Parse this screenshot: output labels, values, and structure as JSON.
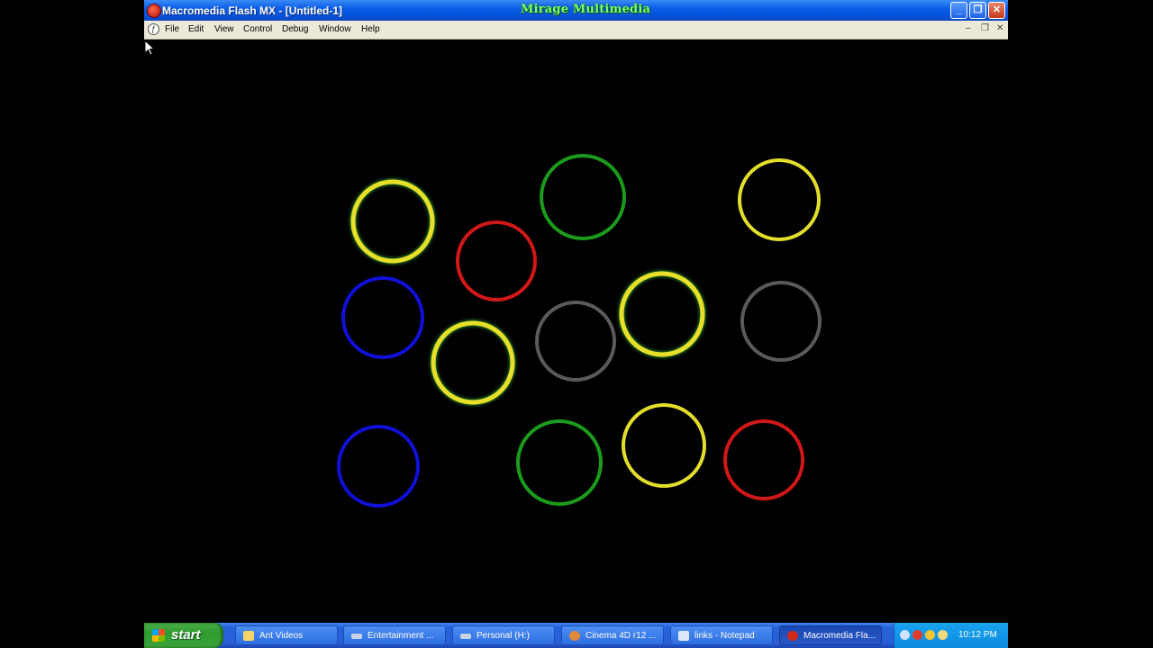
{
  "window": {
    "title": "Macromedia Flash MX - [Untitled-1]",
    "watermark": "Mirage Multimedia",
    "buttons": {
      "minimize": "_",
      "maximize": "❐",
      "close": "✕"
    }
  },
  "menubar": {
    "items": [
      "File",
      "Edit",
      "View",
      "Control",
      "Debug",
      "Window",
      "Help"
    ],
    "mdi_controls": [
      "–",
      "❐",
      "✕"
    ]
  },
  "stage": {
    "background": "#000000",
    "rings": [
      {
        "color": "#e6e02a",
        "glow": true
      },
      {
        "color": "#1c9a1c",
        "glow": false
      },
      {
        "color": "#e2de2a",
        "glow": false
      },
      {
        "color": "#d01818",
        "glow": false
      },
      {
        "color": "#1010d8",
        "glow": false
      },
      {
        "color": "#e6e02a",
        "glow": true
      },
      {
        "color": "#5a5a5a",
        "glow": false
      },
      {
        "color": "#e6e02a",
        "glow": true
      },
      {
        "color": "#5a5a5a",
        "glow": false
      },
      {
        "color": "#1010d8",
        "glow": false
      },
      {
        "color": "#1c9a1c",
        "glow": false
      },
      {
        "color": "#e2de2a",
        "glow": false
      },
      {
        "color": "#d01818",
        "glow": false
      }
    ]
  },
  "taskbar": {
    "start_label": "start",
    "tasks": [
      {
        "label": "Ant Videos",
        "icon": "folder-icon",
        "color": "#f5d56a"
      },
      {
        "label": "Entertainment ...",
        "icon": "drive-icon",
        "color": "#c9d3e6"
      },
      {
        "label": "Personal (H:)",
        "icon": "drive-icon",
        "color": "#c9d3e6"
      },
      {
        "label": "Cinema 4D r12 ...",
        "icon": "cinema4d-icon",
        "color": "#e08a3a"
      },
      {
        "label": "links - Notepad",
        "icon": "notepad-icon",
        "color": "#dfe8f5"
      },
      {
        "label": "Macromedia Fla...",
        "icon": "flash-icon",
        "color": "#d22a1a",
        "active": true
      }
    ],
    "clock": "10:12 PM"
  }
}
